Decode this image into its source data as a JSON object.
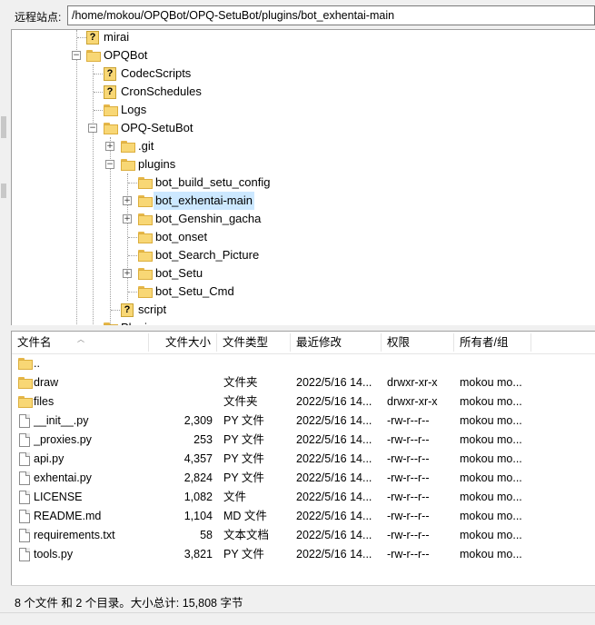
{
  "path_bar": {
    "label": "远程站点:",
    "value": "/home/mokou/OPQBot/OPQ-SetuBot/plugins/bot_exhentai-main"
  },
  "tree": {
    "nodes": [
      {
        "label": "mirai",
        "icon": "question-folder-icon"
      },
      {
        "label": "OPQBot",
        "icon": "folder-icon",
        "expanded": true
      },
      {
        "label": "CodecScripts",
        "icon": "question-folder-icon"
      },
      {
        "label": "CronSchedules",
        "icon": "question-folder-icon"
      },
      {
        "label": "Logs",
        "icon": "folder-icon"
      },
      {
        "label": "OPQ-SetuBot",
        "icon": "folder-icon",
        "expanded": true
      },
      {
        "label": ".git",
        "icon": "folder-icon",
        "expandable": true
      },
      {
        "label": "plugins",
        "icon": "folder-icon",
        "expanded": true
      },
      {
        "label": "bot_build_setu_config",
        "icon": "folder-icon"
      },
      {
        "label": "bot_exhentai-main",
        "icon": "folder-icon",
        "expandable": true,
        "selected": true
      },
      {
        "label": "bot_Genshin_gacha",
        "icon": "folder-icon",
        "expandable": true
      },
      {
        "label": "bot_onset",
        "icon": "folder-icon"
      },
      {
        "label": "bot_Search_Picture",
        "icon": "folder-icon"
      },
      {
        "label": "bot_Setu",
        "icon": "folder-icon",
        "expandable": true
      },
      {
        "label": "bot_Setu_Cmd",
        "icon": "folder-icon"
      },
      {
        "label": "script",
        "icon": "question-folder-icon"
      },
      {
        "label": "Plugins",
        "icon": "folder-icon"
      }
    ]
  },
  "file_list": {
    "columns": [
      "文件名",
      "文件大小",
      "文件类型",
      "最近修改",
      "权限",
      "所有者/组"
    ],
    "rows": [
      {
        "name": "..",
        "size": "",
        "type": "",
        "modified": "",
        "perms": "",
        "owner": "",
        "icon": "folder-icon"
      },
      {
        "name": "draw",
        "size": "",
        "type": "文件夹",
        "modified": "2022/5/16 14...",
        "perms": "drwxr-xr-x",
        "owner": "mokou mo...",
        "icon": "folder-icon"
      },
      {
        "name": "files",
        "size": "",
        "type": "文件夹",
        "modified": "2022/5/16 14...",
        "perms": "drwxr-xr-x",
        "owner": "mokou mo...",
        "icon": "folder-icon"
      },
      {
        "name": "__init__.py",
        "size": "2,309",
        "type": "PY 文件",
        "modified": "2022/5/16 14...",
        "perms": "-rw-r--r--",
        "owner": "mokou mo...",
        "icon": "file-icon"
      },
      {
        "name": "_proxies.py",
        "size": "253",
        "type": "PY 文件",
        "modified": "2022/5/16 14...",
        "perms": "-rw-r--r--",
        "owner": "mokou mo...",
        "icon": "file-icon"
      },
      {
        "name": "api.py",
        "size": "4,357",
        "type": "PY 文件",
        "modified": "2022/5/16 14...",
        "perms": "-rw-r--r--",
        "owner": "mokou mo...",
        "icon": "file-icon"
      },
      {
        "name": "exhentai.py",
        "size": "2,824",
        "type": "PY 文件",
        "modified": "2022/5/16 14...",
        "perms": "-rw-r--r--",
        "owner": "mokou mo...",
        "icon": "file-icon"
      },
      {
        "name": "LICENSE",
        "size": "1,082",
        "type": "文件",
        "modified": "2022/5/16 14...",
        "perms": "-rw-r--r--",
        "owner": "mokou mo...",
        "icon": "file-icon"
      },
      {
        "name": "README.md",
        "size": "1,104",
        "type": "MD 文件",
        "modified": "2022/5/16 14...",
        "perms": "-rw-r--r--",
        "owner": "mokou mo...",
        "icon": "file-icon"
      },
      {
        "name": "requirements.txt",
        "size": "58",
        "type": "文本文档",
        "modified": "2022/5/16 14...",
        "perms": "-rw-r--r--",
        "owner": "mokou mo...",
        "icon": "text-file-icon"
      },
      {
        "name": "tools.py",
        "size": "3,821",
        "type": "PY 文件",
        "modified": "2022/5/16 14...",
        "perms": "-rw-r--r--",
        "owner": "mokou mo...",
        "icon": "file-icon"
      }
    ]
  },
  "status": {
    "text": "8 个文件 和 2 个目录。大小总计: 15,808 字节"
  },
  "colors": {
    "folder": "#f8d775",
    "selection": "#cce8ff"
  }
}
